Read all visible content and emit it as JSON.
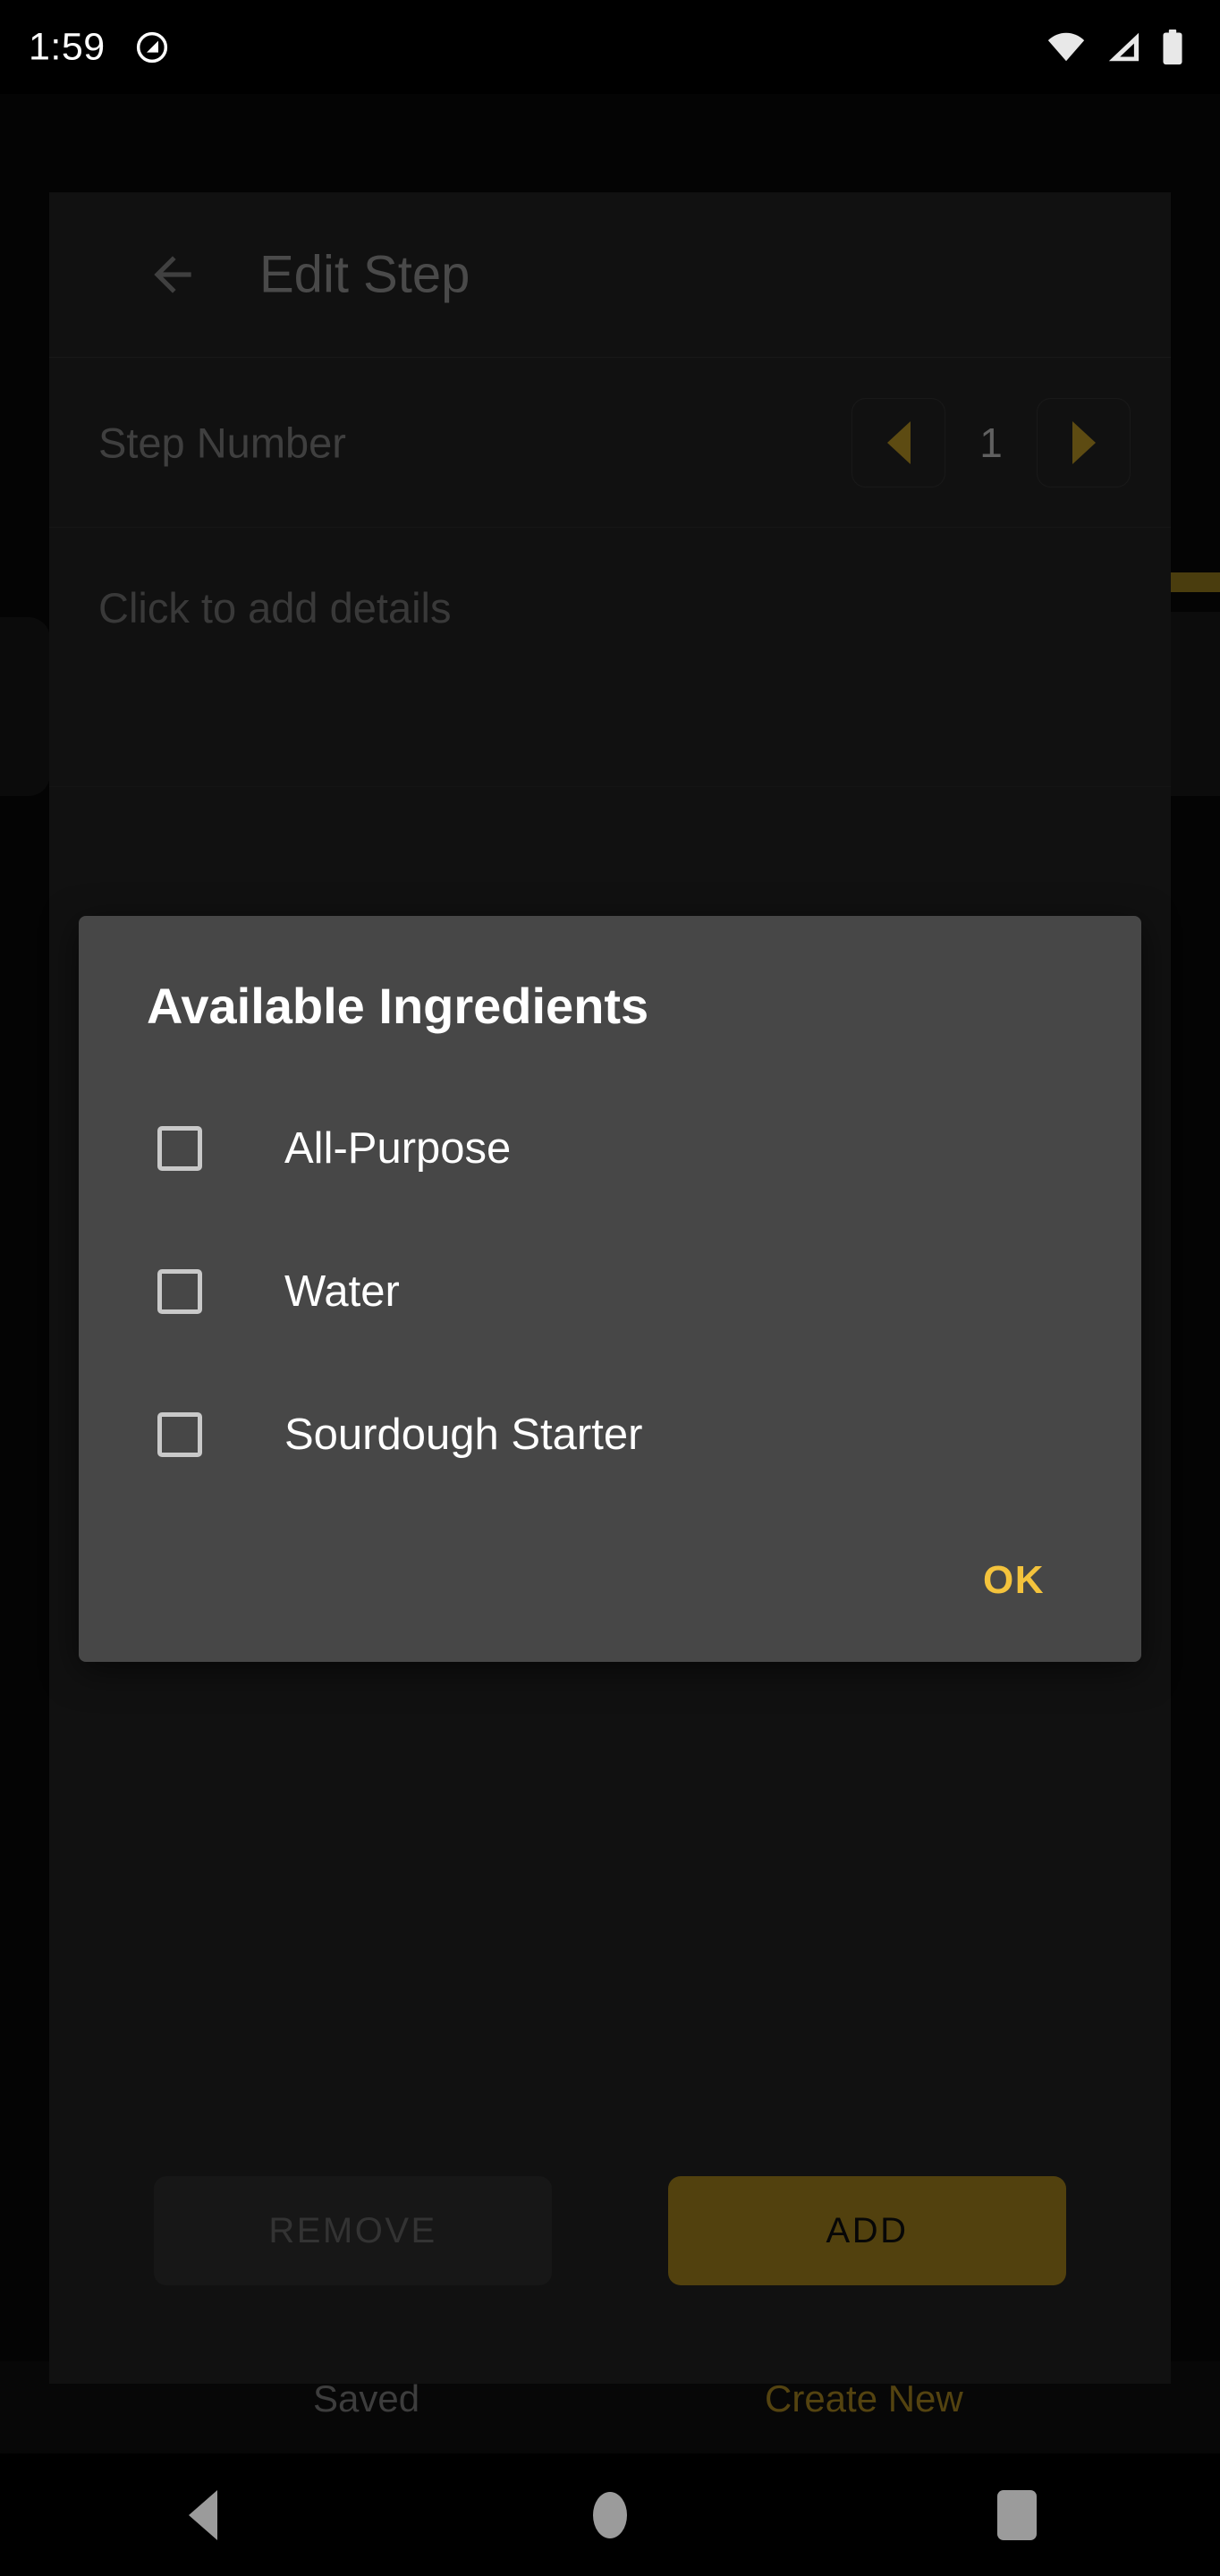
{
  "status_bar": {
    "clock": "1:59",
    "dnd_icon": "do-not-disturb-icon",
    "wifi_icon": "wifi-icon",
    "cellular_icon": "cellular-signal-icon",
    "battery_icon": "battery-icon"
  },
  "sheet": {
    "back_icon": "back-arrow-icon",
    "title": "Edit Step",
    "step_row": {
      "label": "Step Number",
      "decrement_icon": "triangle-left-icon",
      "value": "1",
      "increment_icon": "triangle-right-icon"
    },
    "details": {
      "placeholder": "Click to add details"
    },
    "actions": {
      "remove_label": "REMOVE",
      "add_label": "ADD"
    }
  },
  "bottom_tabs": [
    {
      "label": "Saved",
      "active": false
    },
    {
      "label": "Create New",
      "active": true
    }
  ],
  "dialog": {
    "title": "Available Ingredients",
    "items": [
      {
        "label": "All-Purpose",
        "checked": false
      },
      {
        "label": "Water",
        "checked": false
      },
      {
        "label": "Sourdough Starter",
        "checked": false
      }
    ],
    "ok_label": "OK"
  },
  "nav_bar": {
    "back_icon": "nav-back-icon",
    "home_icon": "nav-home-icon",
    "recents_icon": "nav-recents-icon"
  },
  "colors": {
    "accent": "#f4c33c",
    "accent_dim": "#8a6f1b",
    "dialog_bg": "#474747",
    "sheet_bg": "#1a1a1a",
    "screen_bg": "#000000"
  }
}
